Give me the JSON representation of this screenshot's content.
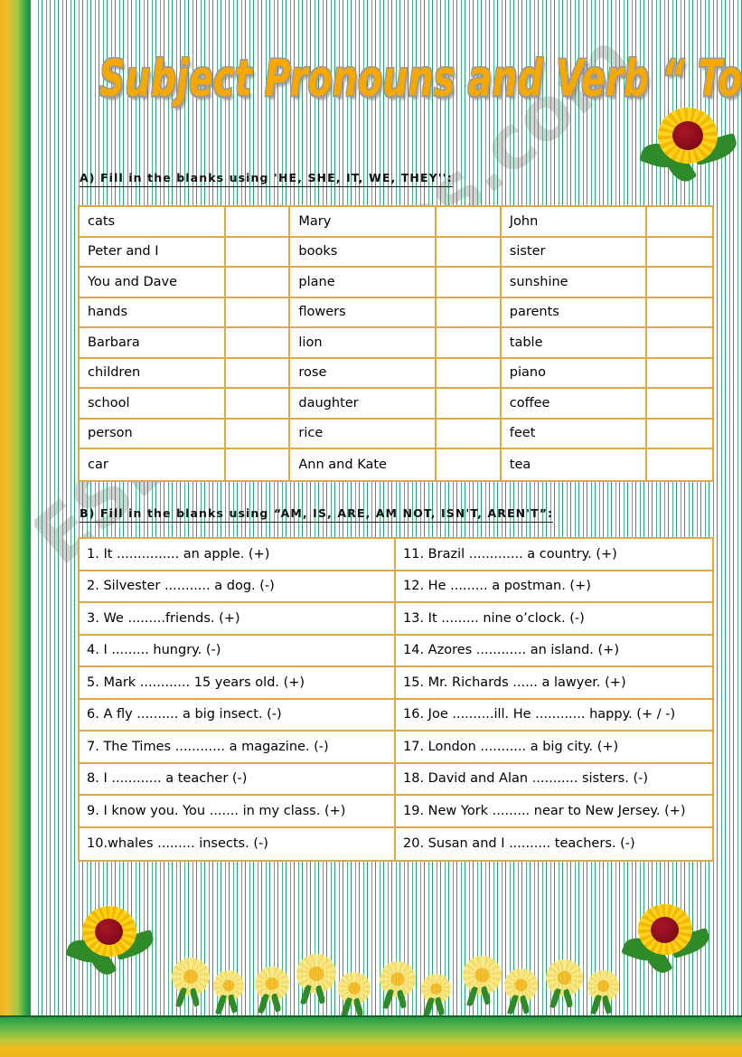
{
  "title": "Subject Pronouns and Verb “ To Be ”",
  "watermark": "ESLprintables.com",
  "sections": {
    "a": {
      "heading": "A) Fill in the blanks using 'HE, SHE, IT, WE, THEY'':",
      "rows": [
        [
          "cats",
          "",
          "Mary",
          "",
          "John",
          ""
        ],
        [
          "Peter and I",
          "",
          "books",
          "",
          "sister",
          ""
        ],
        [
          "You and Dave",
          "",
          "plane",
          "",
          "sunshine",
          ""
        ],
        [
          "hands",
          "",
          "flowers",
          "",
          "parents",
          ""
        ],
        [
          "Barbara",
          "",
          "lion",
          "",
          "table",
          ""
        ],
        [
          "children",
          "",
          "rose",
          "",
          "piano",
          ""
        ],
        [
          "school",
          "",
          "daughter",
          "",
          "coffee",
          ""
        ],
        [
          "person",
          "",
          "rice",
          "",
          "feet",
          ""
        ],
        [
          "car",
          "",
          "Ann and Kate",
          "",
          "tea",
          ""
        ]
      ]
    },
    "b": {
      "heading": "B) Fill in the blanks using “AM, IS, ARE, AM NOT, ISN'T, AREN'T”:",
      "rows": [
        [
          "1. It ............... an apple. (+)",
          "11. Brazil ............. a country. (+)"
        ],
        [
          "2. Silvester ........... a dog. (-)",
          "12. He ......... a postman. (+)"
        ],
        [
          "3. We .........friends. (+)",
          "13. It ......... nine o’clock. (-)"
        ],
        [
          "4. I ......... hungry. (-)",
          "14. Azores ............ an island. (+)"
        ],
        [
          "5. Mark ............ 15 years old. (+)",
          "15. Mr. Richards ...... a lawyer. (+)"
        ],
        [
          "6. A fly .......... a big insect. (-)",
          "16. Joe ..........ill. He ............ happy. (+ / -)"
        ],
        [
          "7. The Times ............ a magazine. (-)",
          "17. London ........... a big city. (+)"
        ],
        [
          "8. I ............ a teacher (-)",
          "18. David and Alan ........... sisters. (-)"
        ],
        [
          "9. I know you. You ....... in my class. (+)",
          "19. New York ......... near to New Jersey. (+)"
        ],
        [
          "10.whales ......... insects. (-)",
          "20. Susan and I .......... teachers. (-)"
        ]
      ]
    }
  },
  "decorations": {
    "sunflower_top_right": "sunflower-icon",
    "sunflower_bottom_left": "sunflower-icon",
    "sunflower_bottom_right": "sunflower-icon",
    "flower_border_count": 11
  },
  "colors": {
    "title": "#f5a800",
    "table_border": "#dca84a",
    "stripe": "#2e9b79",
    "edge_green": "#1f9a46",
    "edge_yellow": "#f0bb1e",
    "sunflower_center": "#8b0e1c",
    "sunflower_petal": "#ffd41a",
    "leaf": "#2f8a2a"
  }
}
